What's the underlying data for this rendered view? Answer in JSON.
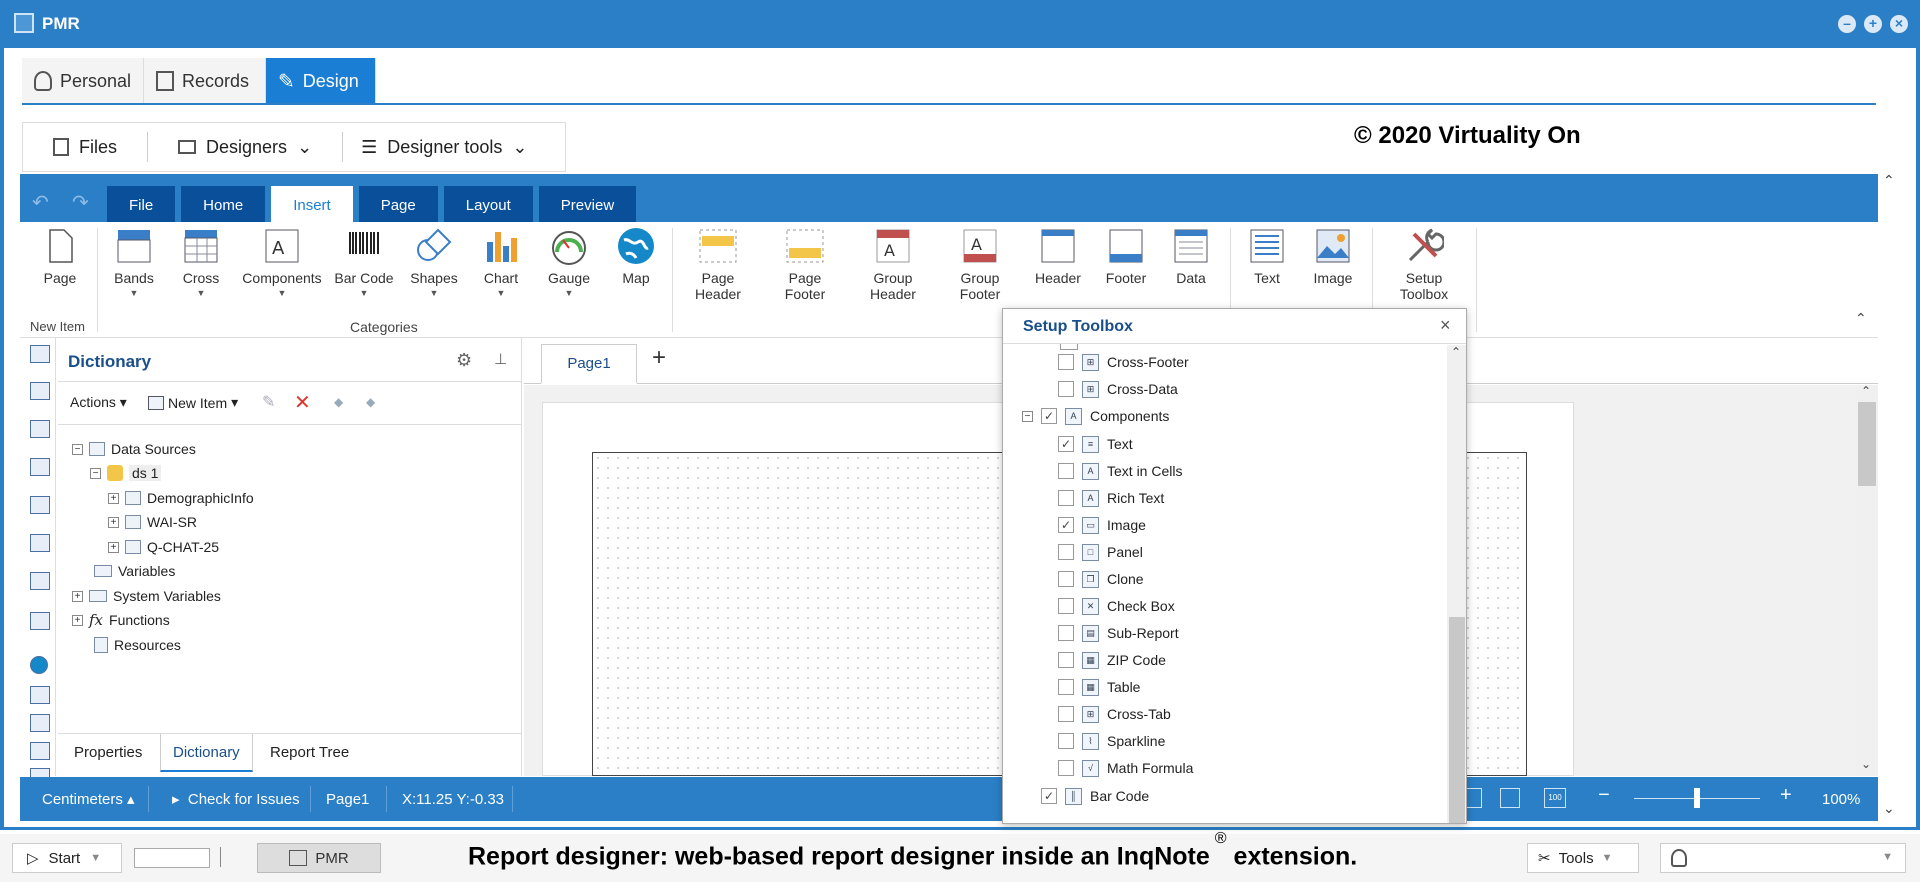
{
  "window": {
    "title": "PMR"
  },
  "nav_tabs": [
    "Personal",
    "Records",
    "Design"
  ],
  "toolbar": {
    "files": "Files",
    "designers": "Designers",
    "designer_tools": "Designer tools"
  },
  "copyright": "© 2020 Virtuality On",
  "ribbon": {
    "tabs": [
      "File",
      "Home",
      "Insert",
      "Page",
      "Layout",
      "Preview"
    ],
    "active_tab": "Insert",
    "items": [
      "Page",
      "Bands",
      "Cross",
      "Components",
      "Bar Code",
      "Shapes",
      "Chart",
      "Gauge",
      "Map"
    ],
    "items2": [
      [
        "Page",
        "Header"
      ],
      [
        "Page",
        "Footer"
      ],
      [
        "Group",
        "Header"
      ],
      [
        "Group",
        "Footer"
      ]
    ],
    "items3": [
      "Header",
      "Footer",
      "Data",
      "Text",
      "Image"
    ],
    "setup": [
      "Setup",
      "Toolbox"
    ],
    "groups": [
      "New Item",
      "Categories"
    ]
  },
  "dictionary": {
    "title": "Dictionary",
    "actions": "Actions",
    "new_item": "New Item",
    "tree": [
      "Data Sources",
      "ds 1",
      "DemographicInfo",
      "WAI-SR",
      "Q-CHAT-25",
      "Variables",
      "System Variables",
      "Functions",
      "Resources"
    ],
    "bottom_tabs": [
      "Properties",
      "Dictionary",
      "Report Tree"
    ]
  },
  "page_tab": "Page1",
  "setup_toolbox": {
    "title": "Setup Toolbox",
    "items": [
      {
        "label": "Cross-Footer",
        "checked": false,
        "level": 2
      },
      {
        "label": "Cross-Data",
        "checked": false,
        "level": 2
      },
      {
        "label": "Components",
        "checked": true,
        "level": 1
      },
      {
        "label": "Text",
        "checked": true,
        "level": 2
      },
      {
        "label": "Text in Cells",
        "checked": false,
        "level": 2
      },
      {
        "label": "Rich Text",
        "checked": false,
        "level": 2
      },
      {
        "label": "Image",
        "checked": true,
        "level": 2
      },
      {
        "label": "Panel",
        "checked": false,
        "level": 2
      },
      {
        "label": "Clone",
        "checked": false,
        "level": 2
      },
      {
        "label": "Check Box",
        "checked": false,
        "level": 2
      },
      {
        "label": "Sub-Report",
        "checked": false,
        "level": 2
      },
      {
        "label": "ZIP Code",
        "checked": false,
        "level": 2
      },
      {
        "label": "Table",
        "checked": false,
        "level": 2
      },
      {
        "label": "Cross-Tab",
        "checked": false,
        "level": 2
      },
      {
        "label": "Sparkline",
        "checked": false,
        "level": 2
      },
      {
        "label": "Math Formula",
        "checked": false,
        "level": 2
      },
      {
        "label": "Bar Code",
        "checked": true,
        "level": 1
      }
    ]
  },
  "status": {
    "units": "Centimeters",
    "check": "Check for Issues",
    "page": "Page1",
    "coords": "X:11.25 Y:-0.33",
    "zoom": "100%",
    "zoom_value": 0.5
  },
  "taskbar": {
    "start": "Start",
    "app": "PMR",
    "caption": "Report designer: web-based report designer inside an InqNote",
    "caption_reg": "®",
    "caption_tail": "extension.",
    "tools": "Tools"
  }
}
